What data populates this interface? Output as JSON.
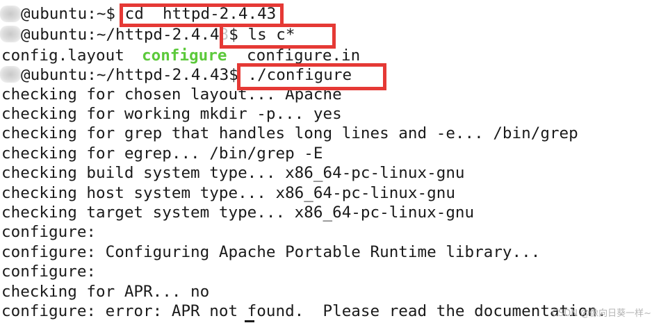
{
  "terminal": {
    "commands": [
      {
        "prompt": "@ubuntu:~$ ",
        "command": "cd  httpd-2.4.43"
      },
      {
        "prompt": "@ubuntu:~/httpd-2.4.4",
        "prompt_hidden_tail": "3",
        "prompt_suffix": "$ ",
        "command": "ls c*"
      },
      {
        "prompt": "@ubuntu:~/httpd-2.4.43$ ",
        "command": "./configure"
      }
    ],
    "ls_output": [
      {
        "name": "config.layout",
        "type": "file"
      },
      {
        "name": "configure",
        "type": "executable"
      },
      {
        "name": "configure.in",
        "type": "file"
      }
    ],
    "output_lines": [
      "checking for chosen layout... Apache",
      "checking for working mkdir -p... yes",
      "checking for grep that handles long lines and -e... /bin/grep",
      "checking for egrep... /bin/grep -E",
      "checking build system type... x86_64-pc-linux-gnu",
      "checking host system type... x86_64-pc-linux-gnu",
      "checking target system type... x86_64-pc-linux-gnu",
      "configure:",
      "configure: Configuring Apache Portable Runtime library...",
      "configure:",
      "checking for APR... no",
      "configure: error: APR not found.  Please read the documentation."
    ]
  },
  "watermark": "CSDN @像向日葵一样~",
  "colors": {
    "highlight_box": "#e53935",
    "executable_file": "#5cc93b",
    "text": "#1a1a1a",
    "background": "#ffffff"
  },
  "icons": {
    "user_avatar": "blurred-username-icon"
  }
}
